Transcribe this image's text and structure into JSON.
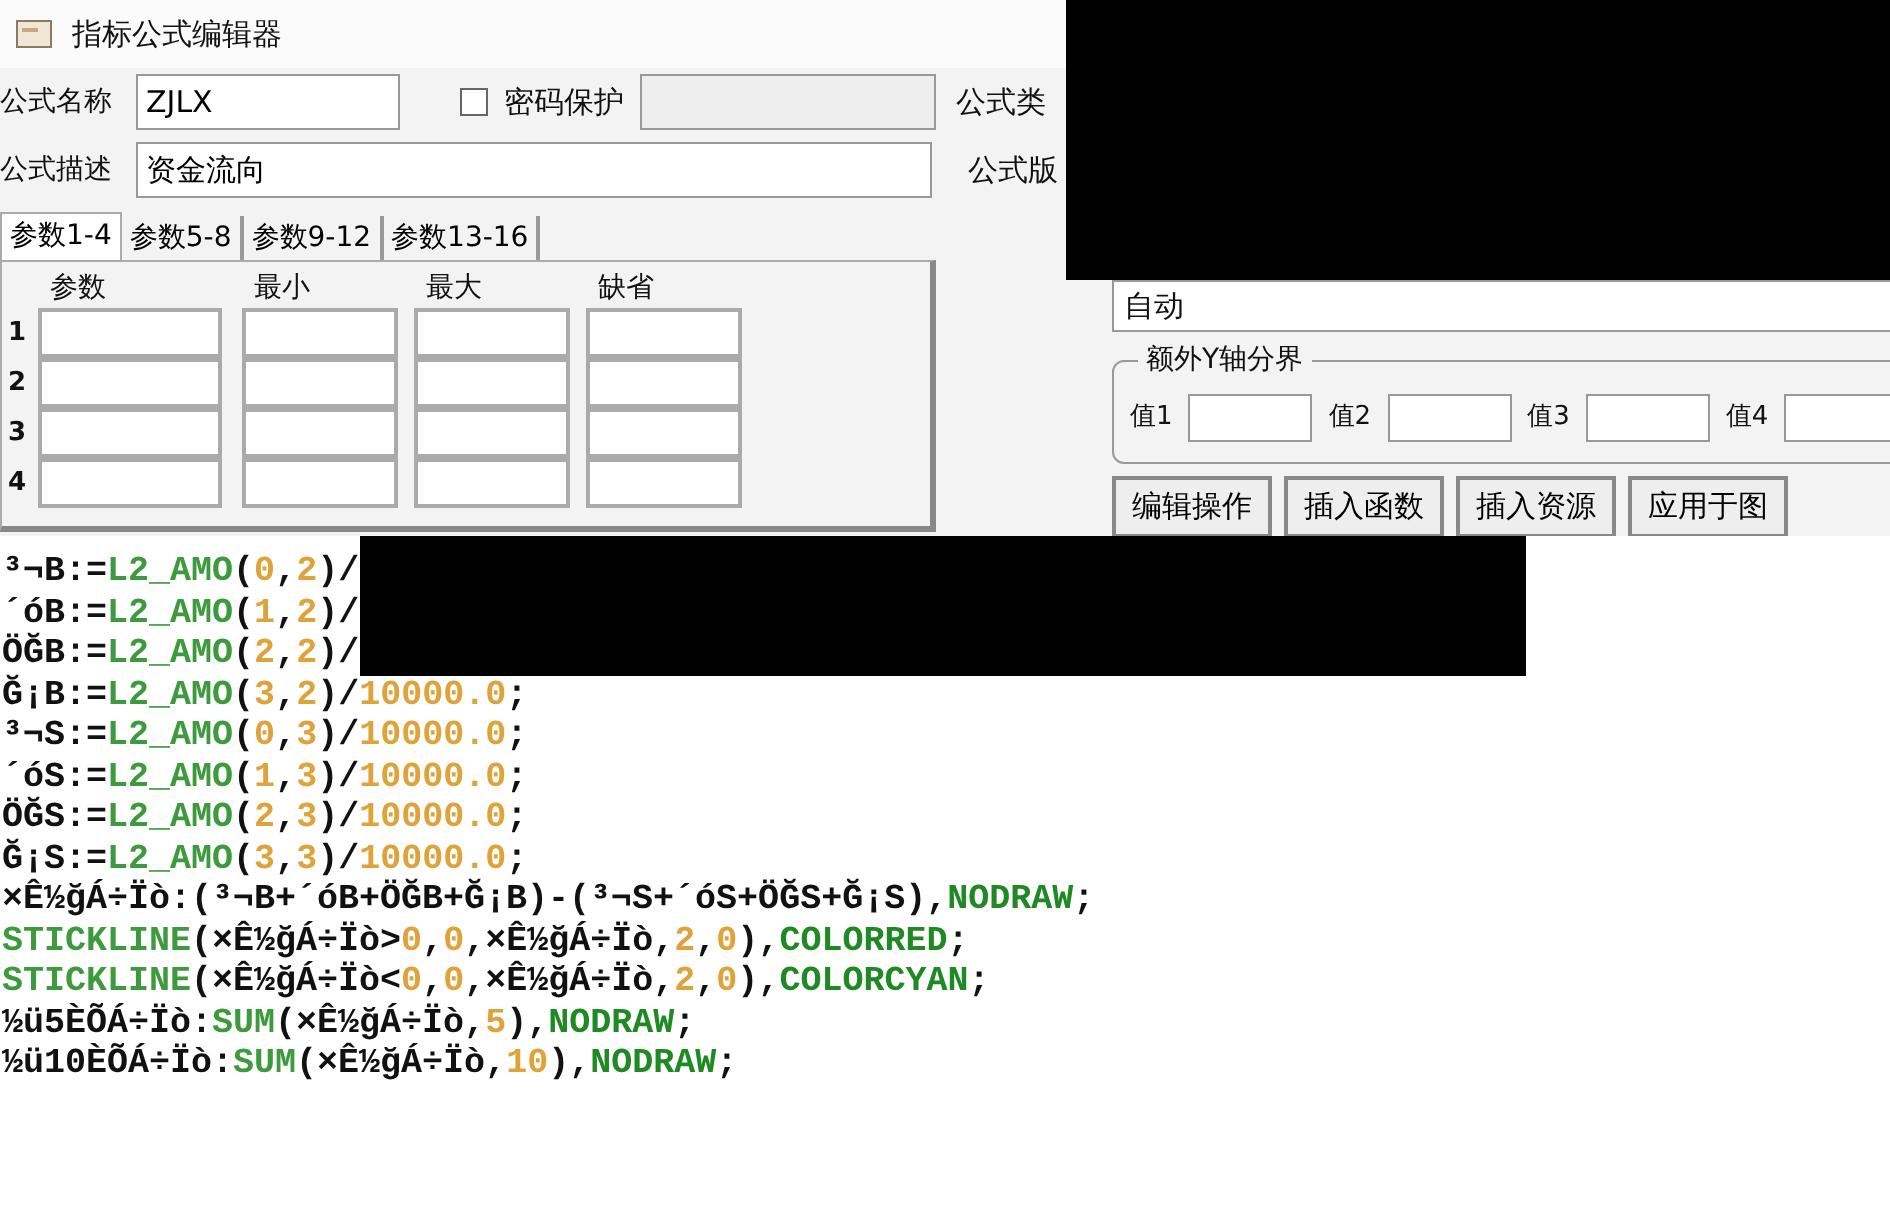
{
  "window": {
    "title": "指标公式编辑器"
  },
  "form": {
    "name_label": "公式名称",
    "name_value": "ZJLX",
    "password": {
      "label": "密码保护",
      "checked": false
    },
    "type_label": "公式类",
    "desc_label": "公式描述",
    "desc_value": "资金流向",
    "version_label": "公式版"
  },
  "param_tabs": [
    {
      "label": "参数1-4",
      "selected": true
    },
    {
      "label": "参数5-8",
      "selected": false
    },
    {
      "label": "参数9-12",
      "selected": false
    },
    {
      "label": "参数13-16",
      "selected": false
    }
  ],
  "param_table": {
    "columns": [
      "参数",
      "最小",
      "最大",
      "缺省"
    ],
    "rows": [
      "1",
      "2",
      "3",
      "4"
    ]
  },
  "right_panel": {
    "field_value": "自动",
    "y_axis_group": {
      "title": "额外Y轴分界",
      "labels": [
        "值1",
        "值2",
        "值3",
        "值4"
      ]
    },
    "buttons": [
      "编辑操作",
      "插入函数",
      "插入资源",
      "应用于图"
    ]
  },
  "code_lines": [
    [
      {
        "kind": "text",
        "text": "³¬B:="
      },
      {
        "kind": "func",
        "text": "L2_AMO"
      },
      {
        "kind": "text",
        "text": "("
      },
      {
        "kind": "num",
        "text": "0"
      },
      {
        "kind": "text",
        "text": ","
      },
      {
        "kind": "num",
        "text": "2"
      },
      {
        "kind": "text",
        "text": ")/"
      }
    ],
    [
      {
        "kind": "text",
        "text": "´óB:="
      },
      {
        "kind": "func",
        "text": "L2_AMO"
      },
      {
        "kind": "text",
        "text": "("
      },
      {
        "kind": "num",
        "text": "1"
      },
      {
        "kind": "text",
        "text": ","
      },
      {
        "kind": "num",
        "text": "2"
      },
      {
        "kind": "text",
        "text": ")/"
      }
    ],
    [
      {
        "kind": "text",
        "text": "ÖĞB:="
      },
      {
        "kind": "func",
        "text": "L2_AMO"
      },
      {
        "kind": "text",
        "text": "("
      },
      {
        "kind": "num",
        "text": "2"
      },
      {
        "kind": "text",
        "text": ","
      },
      {
        "kind": "num",
        "text": "2"
      },
      {
        "kind": "text",
        "text": ")/"
      }
    ],
    [
      {
        "kind": "text",
        "text": "Ğ¡B:="
      },
      {
        "kind": "func",
        "text": "L2_AMO"
      },
      {
        "kind": "text",
        "text": "("
      },
      {
        "kind": "num",
        "text": "3"
      },
      {
        "kind": "text",
        "text": ","
      },
      {
        "kind": "num",
        "text": "2"
      },
      {
        "kind": "text",
        "text": ")/"
      },
      {
        "kind": "num",
        "text": "10000.0"
      },
      {
        "kind": "text",
        "text": ";"
      }
    ],
    [
      {
        "kind": "text",
        "text": "³¬S:="
      },
      {
        "kind": "func",
        "text": "L2_AMO"
      },
      {
        "kind": "text",
        "text": "("
      },
      {
        "kind": "num",
        "text": "0"
      },
      {
        "kind": "text",
        "text": ","
      },
      {
        "kind": "num",
        "text": "3"
      },
      {
        "kind": "text",
        "text": ")/"
      },
      {
        "kind": "num",
        "text": "10000.0"
      },
      {
        "kind": "text",
        "text": ";"
      }
    ],
    [
      {
        "kind": "text",
        "text": "´óS:="
      },
      {
        "kind": "func",
        "text": "L2_AMO"
      },
      {
        "kind": "text",
        "text": "("
      },
      {
        "kind": "num",
        "text": "1"
      },
      {
        "kind": "text",
        "text": ","
      },
      {
        "kind": "num",
        "text": "3"
      },
      {
        "kind": "text",
        "text": ")/"
      },
      {
        "kind": "num",
        "text": "10000.0"
      },
      {
        "kind": "text",
        "text": ";"
      }
    ],
    [
      {
        "kind": "text",
        "text": "ÖĞS:="
      },
      {
        "kind": "func",
        "text": "L2_AMO"
      },
      {
        "kind": "text",
        "text": "("
      },
      {
        "kind": "num",
        "text": "2"
      },
      {
        "kind": "text",
        "text": ","
      },
      {
        "kind": "num",
        "text": "3"
      },
      {
        "kind": "text",
        "text": ")/"
      },
      {
        "kind": "num",
        "text": "10000.0"
      },
      {
        "kind": "text",
        "text": ";"
      }
    ],
    [
      {
        "kind": "text",
        "text": "Ğ¡S:="
      },
      {
        "kind": "func",
        "text": "L2_AMO"
      },
      {
        "kind": "text",
        "text": "("
      },
      {
        "kind": "num",
        "text": "3"
      },
      {
        "kind": "text",
        "text": ","
      },
      {
        "kind": "num",
        "text": "3"
      },
      {
        "kind": "text",
        "text": ")/"
      },
      {
        "kind": "num",
        "text": "10000.0"
      },
      {
        "kind": "text",
        "text": ";"
      }
    ],
    [
      {
        "kind": "text",
        "text": "×Ê½ğÁ÷Ïò:(³¬B+´óB+ÖĞB+Ğ¡B)-(³¬S+´óS+ÖĞS+Ğ¡S),"
      },
      {
        "kind": "keyword",
        "text": "NODRAW"
      },
      {
        "kind": "text",
        "text": ";"
      }
    ],
    [
      {
        "kind": "func",
        "text": "STICKLINE"
      },
      {
        "kind": "text",
        "text": "(×Ê½ğÁ÷Ïò>"
      },
      {
        "kind": "num",
        "text": "0"
      },
      {
        "kind": "text",
        "text": ","
      },
      {
        "kind": "num",
        "text": "0"
      },
      {
        "kind": "text",
        "text": ",×Ê½ğÁ÷Ïò,"
      },
      {
        "kind": "num",
        "text": "2"
      },
      {
        "kind": "text",
        "text": ","
      },
      {
        "kind": "num",
        "text": "0"
      },
      {
        "kind": "text",
        "text": "),"
      },
      {
        "kind": "keyword",
        "text": "COLORRED"
      },
      {
        "kind": "text",
        "text": ";"
      }
    ],
    [
      {
        "kind": "func",
        "text": "STICKLINE"
      },
      {
        "kind": "text",
        "text": "(×Ê½ğÁ÷Ïò<"
      },
      {
        "kind": "num",
        "text": "0"
      },
      {
        "kind": "text",
        "text": ","
      },
      {
        "kind": "num",
        "text": "0"
      },
      {
        "kind": "text",
        "text": ",×Ê½ğÁ÷Ïò,"
      },
      {
        "kind": "num",
        "text": "2"
      },
      {
        "kind": "text",
        "text": ","
      },
      {
        "kind": "num",
        "text": "0"
      },
      {
        "kind": "text",
        "text": "),"
      },
      {
        "kind": "keyword",
        "text": "COLORCYAN"
      },
      {
        "kind": "text",
        "text": ";"
      }
    ],
    [
      {
        "kind": "text",
        "text": "½ü5ÈÕÁ÷Ïò:"
      },
      {
        "kind": "func",
        "text": "SUM"
      },
      {
        "kind": "text",
        "text": "(×Ê½ğÁ÷Ïò,"
      },
      {
        "kind": "num",
        "text": "5"
      },
      {
        "kind": "text",
        "text": "),"
      },
      {
        "kind": "keyword",
        "text": "NODRAW"
      },
      {
        "kind": "text",
        "text": ";"
      }
    ],
    [
      {
        "kind": "text",
        "text": "½ü10ÈÕÁ÷Ïò:"
      },
      {
        "kind": "func",
        "text": "SUM"
      },
      {
        "kind": "text",
        "text": "(×Ê½ğÁ÷Ïò,"
      },
      {
        "kind": "num",
        "text": "10"
      },
      {
        "kind": "text",
        "text": "),"
      },
      {
        "kind": "keyword",
        "text": "NODRAW"
      },
      {
        "kind": "text",
        "text": ";"
      }
    ]
  ]
}
